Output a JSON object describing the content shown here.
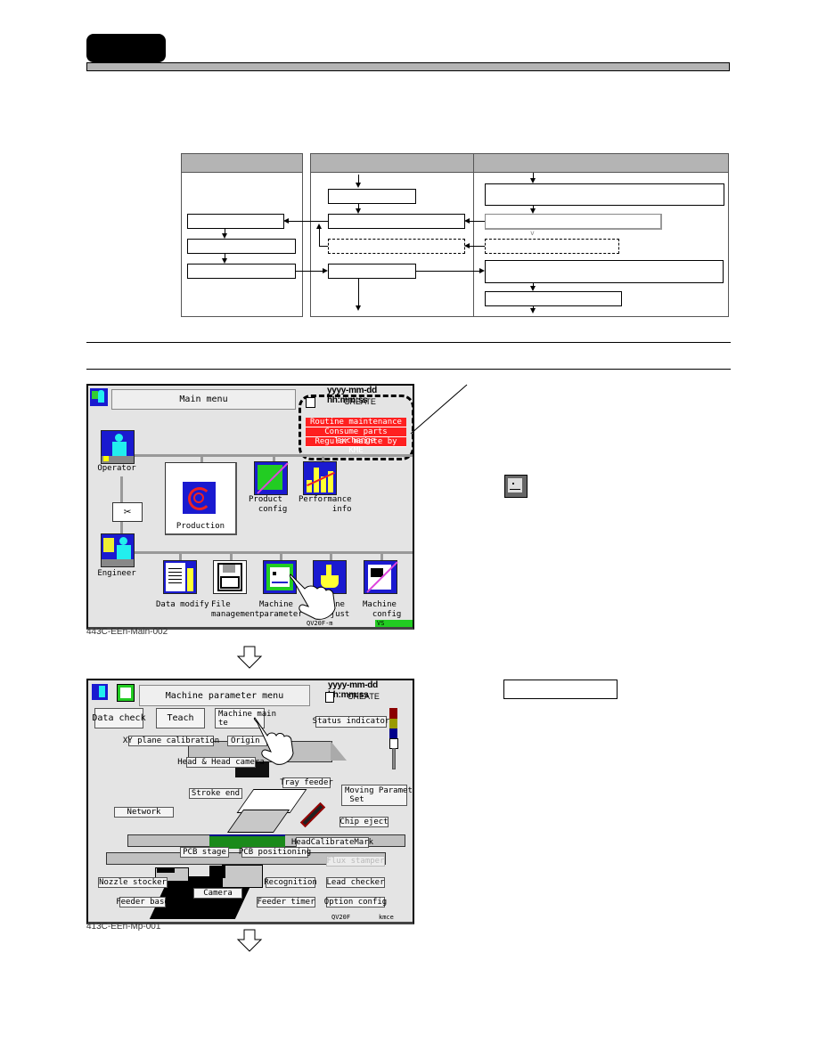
{
  "header": {
    "section_tab": "",
    "section_bar": ""
  },
  "flow_diagram": {
    "columns": [
      {
        "heading": ""
      },
      {
        "heading": ""
      },
      {
        "heading": ""
      }
    ],
    "boxes": {
      "col1": [
        "",
        "",
        ""
      ],
      "col2": [
        "",
        "",
        "",
        ""
      ],
      "col3": [
        "",
        "",
        "",
        "",
        ""
      ]
    }
  },
  "screen1": {
    "title": "Main menu",
    "datetime": "yyyy-mm-dd  hh:mm:ss",
    "mode": "CREATE",
    "maintenance_menu": [
      "Routine maintenance",
      "Consume parts exchange",
      "Regular mainte by KME"
    ],
    "icons": {
      "operator": "Operator",
      "engineer": "Engineer",
      "production": "Production",
      "product_config": "Product\n  config",
      "performance_info": "Performance\n       info",
      "data_modify": "Data modify",
      "file_management": "File\nmanagement",
      "machine_parameter": "Machine\nparameter",
      "machine_adjust": "Machine\n  adjust",
      "machine_config": "Machine\n  config"
    },
    "footer_left": "QV20F-m",
    "footer_right": "VS License",
    "caption": "443C-EEn-Main-002"
  },
  "screen2": {
    "title": "Machine parameter menu",
    "datetime": "yyyy-mm-dd  hh:mm:ss",
    "mode": "CREATE",
    "buttons": {
      "data_check": "Data check",
      "teach": "Teach",
      "machine_mainte": "Machine main\nte",
      "status_indicator": "Status indicator",
      "xy_plane_calibration": "XY plane calibration",
      "origin": "Origin",
      "head_camera": "Head & Head camera",
      "tray_feeder": "Tray feeder",
      "stroke_end": "Stroke end",
      "moving_parameter_set": "Moving Parameter\n Set",
      "network": "Network",
      "chip_eject": "Chip eject",
      "head_calibrate_mark": "HeadCalibrateMark",
      "pcb_stage": "PCB stage",
      "pcb_positioning": "PCB positioning",
      "flux_stamper": "Flux stamper",
      "nozzle_stocker": "Nozzle stocker",
      "recognition": "Recognition",
      "lead_checker": "Lead checker",
      "camera": "Camera",
      "feeder_base": "Feeder base",
      "feeder_timer": "Feeder timer",
      "option_config": "Option config"
    },
    "footer_left": "QV20F",
    "footer_right": "kmce",
    "caption": "413C-EEn-Mp-001"
  },
  "annotations": {
    "callout_box_label": ""
  },
  "colors": {
    "header_gray": "#b4b4b4",
    "screen_bg": "#e4e4e4",
    "maintenance_red": "#ff2020",
    "icon_blue": "#1a1ad0",
    "status_red": "#8b0000",
    "status_yellow": "#9a9a00",
    "status_blue": "#00008b",
    "license_green": "#22cc22"
  }
}
